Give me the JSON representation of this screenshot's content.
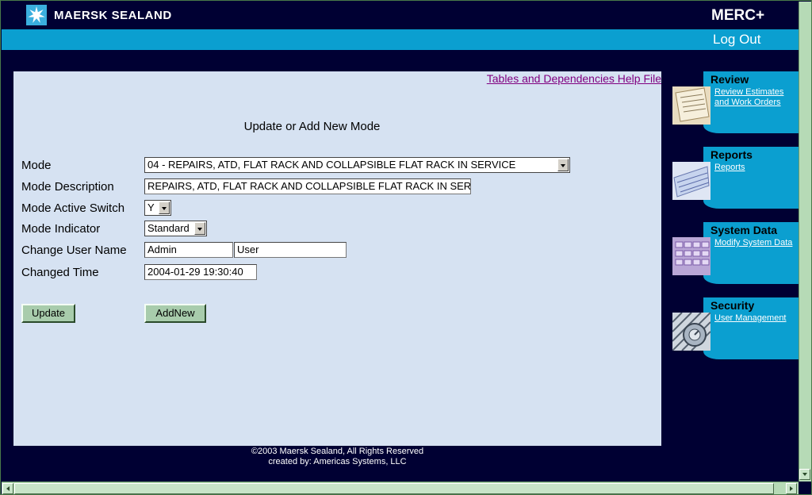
{
  "header": {
    "brand": "MAERSK SEALAND",
    "app_title": "MERC+",
    "logout": "Log Out"
  },
  "main": {
    "help_link": "Tables and Dependencies Help File",
    "title": "Update or Add New Mode",
    "fields": {
      "mode_label": "Mode",
      "mode_value": "04 - REPAIRS, ATD, FLAT RACK AND COLLAPSIBLE FLAT RACK IN SERVICE",
      "desc_label": "Mode Description",
      "desc_value": "REPAIRS, ATD, FLAT RACK AND COLLAPSIBLE FLAT RACK IN SERVICE",
      "active_label": "Mode Active Switch",
      "active_value": "Y",
      "indicator_label": "Mode Indicator",
      "indicator_value": "Standard",
      "user_label": "Change User Name",
      "user_first": "Admin",
      "user_last": "User",
      "time_label": "Changed Time",
      "time_value": "2004-01-29 19:30:40"
    },
    "buttons": {
      "update": "Update",
      "addnew": "AddNew"
    }
  },
  "footer": {
    "copyright": "©2003 Maersk Sealand, All Rights Reserved",
    "created_by": "created by: Americas Systems, LLC"
  },
  "sidebar": [
    {
      "title": "Review",
      "link": "Review Estimates and Work Orders"
    },
    {
      "title": "Reports",
      "link": "Reports"
    },
    {
      "title": "System Data",
      "link": "Modify System Data"
    },
    {
      "title": "Security",
      "link": "User Management"
    }
  ],
  "colors": {
    "background": "#000033",
    "accent": "#0b9fd0",
    "panel": "#d6e2f2",
    "button": "#a8ccac"
  }
}
